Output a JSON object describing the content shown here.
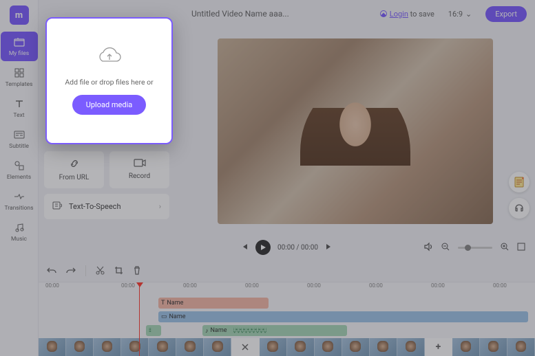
{
  "logo": "m",
  "sidebar": {
    "items": [
      {
        "label": "My files"
      },
      {
        "label": "Templates"
      },
      {
        "label": "Text"
      },
      {
        "label": "Subtitle"
      },
      {
        "label": "Elements"
      },
      {
        "label": "Transitions"
      },
      {
        "label": "Music"
      }
    ]
  },
  "header": {
    "title": "Untitled Video Name aaa...",
    "login_prefix": "Login",
    "login_suffix": " to save",
    "ratio": "16:9",
    "export": "Export"
  },
  "panel": {
    "from_url": "From URL",
    "record": "Record",
    "tts": "Text-To-Speech"
  },
  "popup": {
    "hint": "Add file or drop files here or",
    "button": "Upload media"
  },
  "controls": {
    "time": "00:00 / 00:00"
  },
  "timeline": {
    "marks": [
      "00:00",
      "00:00",
      "00:00",
      "00:00",
      "00:00",
      "00:00",
      "00:00",
      "00:00"
    ],
    "track1": "Name",
    "track2": "Name",
    "track4": "Name"
  }
}
